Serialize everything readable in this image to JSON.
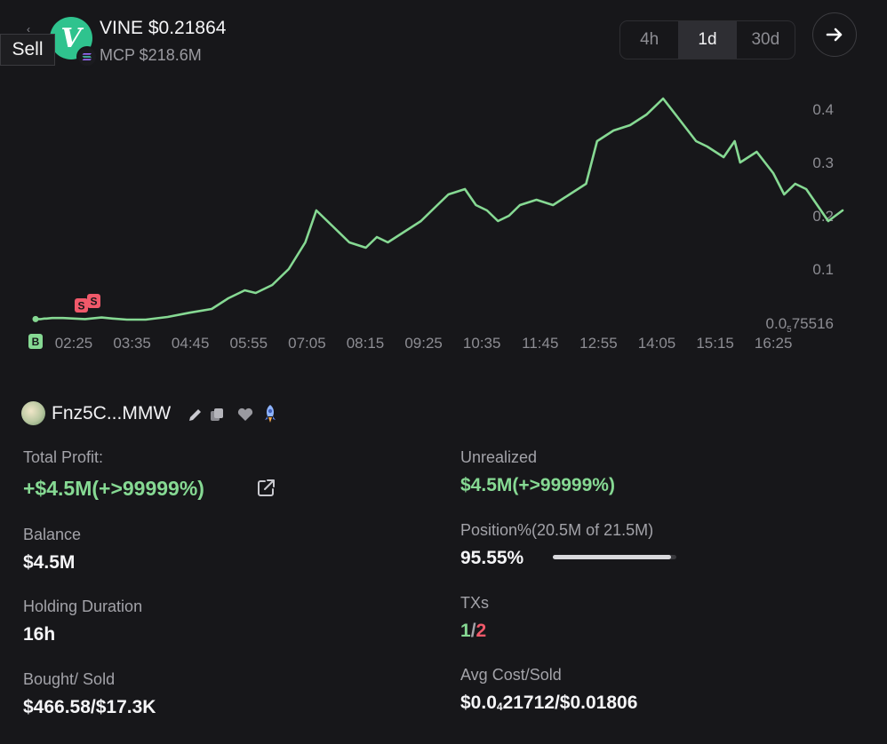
{
  "token": {
    "logo_letter": "V",
    "title": "VINE $0.21864",
    "mcp": "MCP $218.6M"
  },
  "sell_tag": "Sell",
  "timeframes": [
    {
      "label": "4h",
      "active": false
    },
    {
      "label": "1d",
      "active": true
    },
    {
      "label": "30d",
      "active": false
    }
  ],
  "colors": {
    "accent_green": "#86d993",
    "sell_red": "#f0596a",
    "background": "#17171a"
  },
  "chart_data": {
    "type": "line",
    "y_ticks": [
      "0.4",
      "0.3",
      "0.2",
      "0.1"
    ],
    "y_bottom_label": "0.0",
    "y_bottom_subscript": "5",
    "y_bottom_rest": "75516",
    "x_ticks": [
      "02:25",
      "03:35",
      "04:45",
      "05:55",
      "07:05",
      "08:15",
      "09:25",
      "10:35",
      "11:45",
      "12:55",
      "14:05",
      "15:15",
      "16:25"
    ],
    "ylim": [
      0,
      0.45
    ],
    "x": [
      0.0,
      0.05,
      0.08,
      0.1,
      0.15,
      0.25,
      0.35,
      0.45,
      0.6,
      0.7,
      0.83,
      1.0,
      1.2,
      1.4,
      1.6,
      1.75,
      1.9,
      2.0,
      2.15,
      2.3,
      2.45,
      2.55,
      2.7,
      2.85,
      3.0,
      3.1,
      3.2,
      3.35,
      3.5,
      3.6,
      3.75,
      3.9,
      4.0,
      4.1,
      4.2,
      4.3,
      4.4,
      4.55,
      4.7,
      4.85,
      5.0,
      5.1,
      5.25,
      5.4,
      5.55,
      5.7,
      5.85,
      6.0,
      6.1,
      6.25,
      6.35,
      6.4,
      6.55,
      6.7,
      6.8,
      6.9,
      7.0,
      7.1,
      7.2,
      7.33
    ],
    "series": [
      {
        "values": [
          0.006,
          0.006,
          0.007,
          0.007,
          0.008,
          0.008,
          0.007,
          0.006,
          0.009,
          0.007,
          0.005,
          0.005,
          0.01,
          0.018,
          0.025,
          0.045,
          0.06,
          0.055,
          0.07,
          0.1,
          0.15,
          0.21,
          0.18,
          0.15,
          0.14,
          0.16,
          0.15,
          0.17,
          0.19,
          0.21,
          0.24,
          0.25,
          0.22,
          0.21,
          0.19,
          0.2,
          0.22,
          0.23,
          0.22,
          0.24,
          0.26,
          0.34,
          0.36,
          0.37,
          0.39,
          0.42,
          0.38,
          0.34,
          0.33,
          0.31,
          0.34,
          0.3,
          0.32,
          0.28,
          0.24,
          0.26,
          0.25,
          0.22,
          0.19,
          0.21
        ]
      }
    ]
  },
  "wallet": {
    "name": "Fnz5C...MMW"
  },
  "stats": {
    "total_profit_label": "Total Profit:",
    "total_profit_value": "+$4.5M(+>99999%)",
    "unrealized_label": "Unrealized",
    "unrealized_value": "$4.5M(+>99999%)",
    "balance_label": "Balance",
    "balance_value": "$4.5M",
    "position_label": "Position%(20.5M of 21.5M)",
    "position_value": "95.55%",
    "position_fraction": 0.9555,
    "holding_label": "Holding Duration",
    "holding_value": "16h",
    "txs_label": "TXs",
    "txs_buys": "1",
    "txs_sep": "/",
    "txs_sells": "2",
    "bought_sold_label": "Bought/ Sold",
    "bought_sold_value": "$466.58/$17.3K",
    "avg_cost_label": "Avg Cost/Sold",
    "avg_cost_prefix": "$0.0",
    "avg_cost_subscript": "4",
    "avg_cost_rest": "21712/$0.01806"
  },
  "markers": {
    "buy_letter": "B",
    "sell_letter": "S"
  }
}
